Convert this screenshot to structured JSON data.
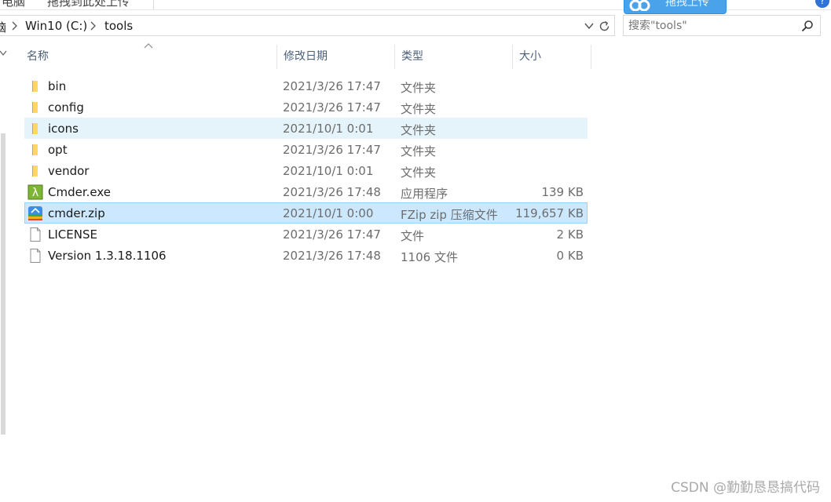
{
  "top_strip": {
    "clipped_left": "电脑",
    "clipped_middle": "拖拽到此处上传",
    "upload_button_label": "拖拽上传",
    "help": "?"
  },
  "address_bar": {
    "crumbs": [
      {
        "label": "Win10 (C:)"
      },
      {
        "label": "tools"
      }
    ],
    "clipped_leading": "脑"
  },
  "search": {
    "placeholder": "搜索\"tools\""
  },
  "columns": {
    "name": "名称",
    "date": "修改日期",
    "type": "类型",
    "size": "大小",
    "sort_column": "name"
  },
  "files": [
    {
      "name": "bin",
      "date": "2021/3/26 17:47",
      "type": "文件夹",
      "size": "",
      "icon": "folder-icon",
      "state": "normal"
    },
    {
      "name": "config",
      "date": "2021/3/26 17:47",
      "type": "文件夹",
      "size": "",
      "icon": "folder-icon",
      "state": "normal"
    },
    {
      "name": "icons",
      "date": "2021/10/1 0:01",
      "type": "文件夹",
      "size": "",
      "icon": "folder-icon",
      "state": "hover"
    },
    {
      "name": "opt",
      "date": "2021/3/26 17:47",
      "type": "文件夹",
      "size": "",
      "icon": "folder-icon",
      "state": "normal"
    },
    {
      "name": "vendor",
      "date": "2021/10/1 0:01",
      "type": "文件夹",
      "size": "",
      "icon": "folder-icon",
      "state": "normal"
    },
    {
      "name": "Cmder.exe",
      "date": "2021/3/26 17:48",
      "type": "应用程序",
      "size": "139 KB",
      "icon": "cmder-lambda-icon",
      "state": "normal"
    },
    {
      "name": "cmder.zip",
      "date": "2021/10/1 0:00",
      "type": "FZip zip 压缩文件",
      "size": "119,657 KB",
      "icon": "zip-archive-icon",
      "state": "selected"
    },
    {
      "name": "LICENSE",
      "date": "2021/3/26 17:47",
      "type": "文件",
      "size": "2 KB",
      "icon": "blank-file-icon",
      "state": "normal"
    },
    {
      "name": "Version 1.3.18.1106",
      "date": "2021/3/26 17:48",
      "type": "1106 文件",
      "size": "0 KB",
      "icon": "blank-file-icon",
      "state": "normal"
    }
  ],
  "watermark": "CSDN @勤勤恳恳搞代码",
  "colors": {
    "selected_bg": "#cce8ff",
    "selected_border": "#99d1ff",
    "hover_bg": "#e5f3fb",
    "folder_yellow": "#f8c74b",
    "header_text": "#4c607a"
  }
}
